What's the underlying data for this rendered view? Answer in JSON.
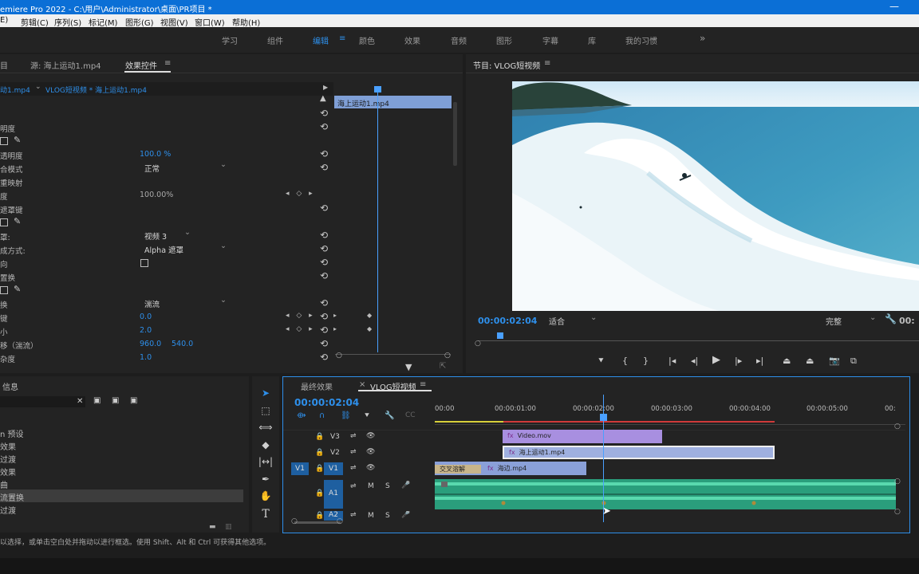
{
  "titlebar": {
    "title": "emiere Pro 2022 - C:\\用户\\Administrator\\桌面\\PR项目 *",
    "minimize": "—"
  },
  "menu": [
    "E)",
    "剪辑(C)",
    "序列(S)",
    "标记(M)",
    "图形(G)",
    "视图(V)",
    "窗口(W)",
    "帮助(H)"
  ],
  "workspaces": [
    {
      "label": "学习"
    },
    {
      "label": "组件"
    },
    {
      "label": "编辑"
    },
    {
      "label": "≡"
    },
    {
      "label": "颜色"
    },
    {
      "label": "效果"
    },
    {
      "label": "音频"
    },
    {
      "label": "图形"
    },
    {
      "label": "字幕"
    },
    {
      "label": "库"
    },
    {
      "label": "我的习惯"
    },
    {
      "label": "»"
    }
  ],
  "effect_controls": {
    "tabs": [
      "目",
      "源: 海上运动1.mp4",
      "效果控件",
      "≡"
    ],
    "source_select": "动1.mp4",
    "sequence_clip": "VLOG短视频 * 海上运动1.mp4",
    "timeline_clip": "海上运动1.mp4",
    "rows": [
      {
        "label": "明度"
      },
      {
        "label": ""
      },
      {
        "label": "透明度",
        "value": "100.0 %"
      },
      {
        "label": "合模式",
        "select": "正常"
      },
      {
        "label": "重映射"
      },
      {
        "label": "度",
        "value": "100.00%"
      },
      {
        "label": "遮罩键"
      },
      {
        "label": ""
      },
      {
        "label": "罩:",
        "select": "视频 3"
      },
      {
        "label": "成方式:",
        "select": "Alpha 遮罩"
      },
      {
        "label": "向"
      },
      {
        "label": "置换"
      },
      {
        "label": ""
      },
      {
        "label": "换",
        "select": "湍流"
      },
      {
        "label": "键",
        "value": "0.0"
      },
      {
        "label": "小",
        "value": "2.0"
      },
      {
        "label": "移（湍流）",
        "value": "960.0",
        "value2": "540.0"
      },
      {
        "label": "杂度",
        "value": "1.0"
      }
    ]
  },
  "program_monitor": {
    "tab": "节目: VLOG短视频",
    "timecode": "00:00:02:04",
    "fit": "适合",
    "quality": "完整",
    "timecode_right": "00:"
  },
  "project_panel": {
    "tab": "信息",
    "items": [
      {
        "label": "n 预设"
      },
      {
        "label": "效果"
      },
      {
        "label": "过渡"
      },
      {
        "label": "效果"
      },
      {
        "label": "曲"
      },
      {
        "label": "流置换"
      },
      {
        "label": "过渡"
      }
    ],
    "selected_index": 5
  },
  "timeline": {
    "tabs": [
      "最终效果",
      "×",
      "VLOG短视频",
      "≡"
    ],
    "timecode": "00:00:02:04",
    "ruler": [
      "00:00",
      "00:00:01:00",
      "00:00:02:00",
      "00:00:03:00",
      "00:00:04:00",
      "00:00:05:00",
      "00:"
    ],
    "tracks": [
      {
        "name": "V3"
      },
      {
        "name": "V2"
      },
      {
        "name": "V1",
        "source": "V1"
      },
      {
        "name": "A1"
      },
      {
        "name": "A2"
      }
    ],
    "track_buttons": {
      "mute": "M",
      "solo": "S"
    },
    "clips": [
      {
        "label": "Video.mov",
        "fx": "fx"
      },
      {
        "label": "海上运动1.mp4",
        "fx": "fx"
      },
      {
        "label": "海边.mp4",
        "fx": "fx"
      },
      {
        "label": "交叉溶解"
      }
    ]
  },
  "statusbar": {
    "text": "以选择，或单击空白处并拖动以进行框选。使用 Shift、Alt 和 Ctrl 可获得其他选项。"
  },
  "colors": {
    "accent": "#2e8fea",
    "video_clip": "#9fb0e0",
    "purple_clip": "#a88fe0",
    "audio": "#2fb88c",
    "playhead": "#4aa0ff"
  }
}
